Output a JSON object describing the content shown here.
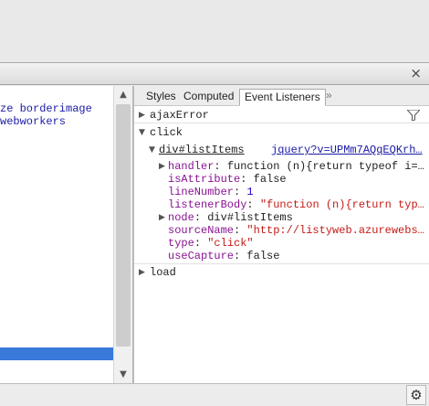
{
  "titlebar": {
    "close_glyph": "×"
  },
  "left_pane": {
    "lines": [
      "ze borderimage",
      "webworkers"
    ]
  },
  "tabs": [
    {
      "label": "Styles"
    },
    {
      "label": "Computed"
    },
    {
      "label": "Event Listeners"
    }
  ],
  "tabs_more": "»",
  "events": {
    "ajaxError": "ajaxError",
    "click": "click",
    "load": "load"
  },
  "listener": {
    "node": "div#listItems",
    "source_link": "jquery?v=UPMm7AQqEQKrh…",
    "props": {
      "handler_name": "handler",
      "handler_value": "function (n){return typeof i=…",
      "isAttribute_name": "isAttribute",
      "isAttribute_value": "false",
      "lineNumber_name": "lineNumber",
      "lineNumber_value": "1",
      "listenerBody_name": "listenerBody",
      "listenerBody_value": "\"function (n){return typ…",
      "node_name": "node",
      "node_value": "div#listItems",
      "sourceName_name": "sourceName",
      "sourceName_value": "\"http://listyweb.azurewebs…",
      "type_name": "type",
      "type_value": "\"click\"",
      "useCapture_name": "useCapture",
      "useCapture_value": "false"
    }
  },
  "icons": {
    "close": "close-icon",
    "filter": "filter-icon",
    "settings": "gear-icon"
  },
  "colors": {
    "selection": "#3879d9",
    "property_name": "#881391",
    "string_value": "#c41a16",
    "number_value": "#1c00cf",
    "link": "#1a1aa6"
  }
}
